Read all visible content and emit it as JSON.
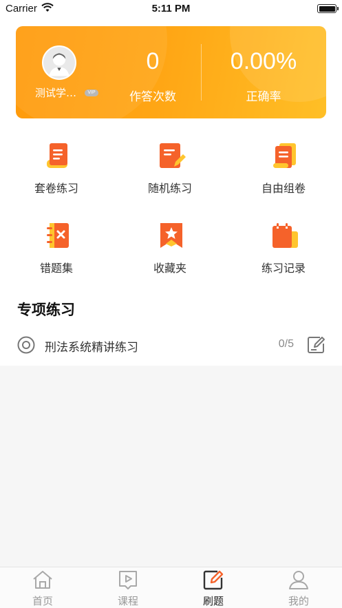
{
  "status_bar": {
    "carrier": "Carrier",
    "time": "5:11 PM"
  },
  "profile": {
    "user_name": "测试学…",
    "vip_label": "VIP",
    "answer_count": "0",
    "answer_count_label": "作答次数",
    "accuracy": "0.00%",
    "accuracy_label": "正确率"
  },
  "grid": [
    {
      "label": "套卷练习",
      "icon": "scroll-paper-icon"
    },
    {
      "label": "随机练习",
      "icon": "document-pen-icon"
    },
    {
      "label": "自由组卷",
      "icon": "stacked-papers-icon"
    },
    {
      "label": "错题集",
      "icon": "wrong-notebook-icon"
    },
    {
      "label": "收藏夹",
      "icon": "bookmark-star-icon"
    },
    {
      "label": "练习记录",
      "icon": "notepad-record-icon"
    }
  ],
  "section": {
    "title": "专项练习"
  },
  "practice_items": [
    {
      "name": "刑法系统精讲练习",
      "progress": "0/5"
    }
  ],
  "tabs": [
    {
      "label": "首页",
      "icon": "home-icon",
      "active": false
    },
    {
      "label": "课程",
      "icon": "course-play-icon",
      "active": false
    },
    {
      "label": "刷题",
      "icon": "practice-edit-icon",
      "active": true
    },
    {
      "label": "我的",
      "icon": "profile-person-icon",
      "active": false
    }
  ],
  "colors": {
    "accent_orange": "#ff9a0b",
    "accent_yellow": "#ffbf26",
    "icon_red_orange": "#f5622a",
    "icon_yellow": "#ffc52e"
  }
}
